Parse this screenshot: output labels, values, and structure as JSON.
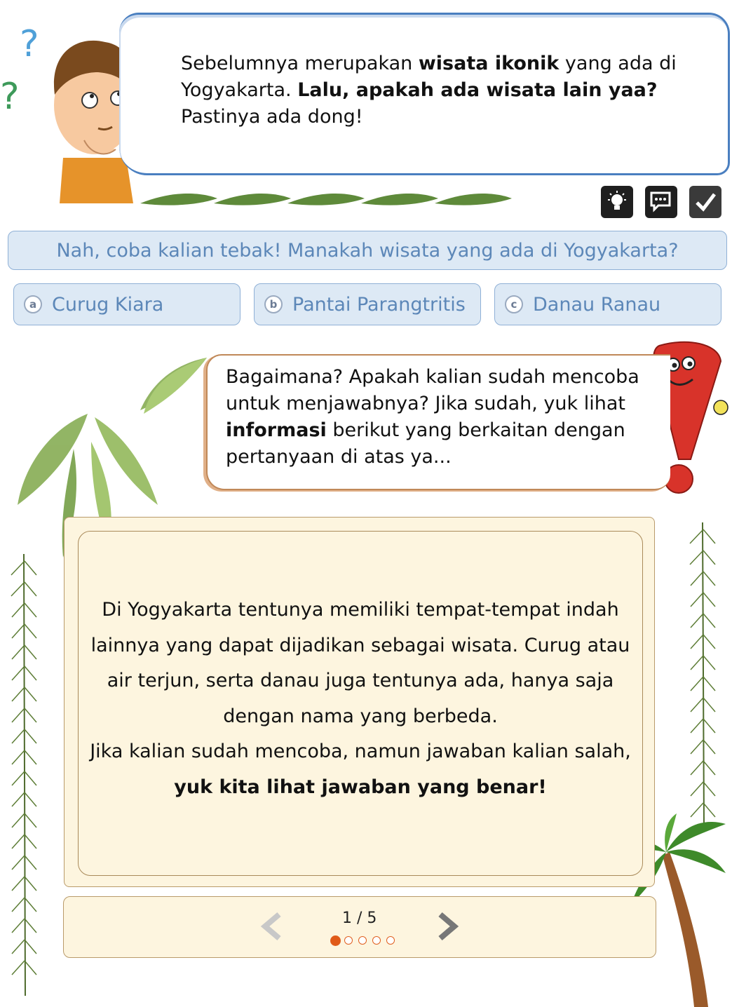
{
  "bubble1": {
    "line1_pre": "Sebelumnya merupakan ",
    "line1_bold": "wisata ikonik",
    "line1_post": " yang ada di",
    "line2_pre": "Yogyakarta. ",
    "line2_bold": "Lalu, apakah ada wisata lain yaa?",
    "line3": "Pastinya ada dong!"
  },
  "toolbar": {
    "hint_icon": "lightbulb-icon",
    "discussion_icon": "discussion-icon",
    "check_icon": "checkmark-icon"
  },
  "question": "Nah, coba kalian tebak! Manakah wisata yang ada di Yogyakarta?",
  "options": [
    {
      "badge": "a",
      "label": "Curug Kiara"
    },
    {
      "badge": "b",
      "label": "Pantai Parangtritis"
    },
    {
      "badge": "c",
      "label": "Danau Ranau"
    }
  ],
  "bubble2": {
    "p1": "Bagaimana? Apakah kalian sudah mencoba untuk menjawabnya? Jika sudah, yuk lihat ",
    "bold": "informasi",
    "p2": " berikut yang berkaitan dengan pertanyaan di atas ya..."
  },
  "card": {
    "p1": "Di Yogyakarta tentunya memiliki tempat-tempat indah lainnya yang dapat dijadikan sebagai wisata. Curug atau air terjun, serta danau juga tentunya ada, hanya saja dengan nama yang berbeda.",
    "p2_pre": "Jika kalian sudah mencoba, namun jawaban kalian salah, ",
    "p2_bold": "yuk kita lihat jawaban yang benar!"
  },
  "pager": {
    "count": "1 / 5",
    "current": 1,
    "total": 5
  },
  "colors": {
    "bubble_border": "#4a7fc0",
    "option_bg": "#dde9f5",
    "option_text": "#5c87b8",
    "card_bg": "#fdf5df",
    "dot_active": "#e05a18"
  }
}
